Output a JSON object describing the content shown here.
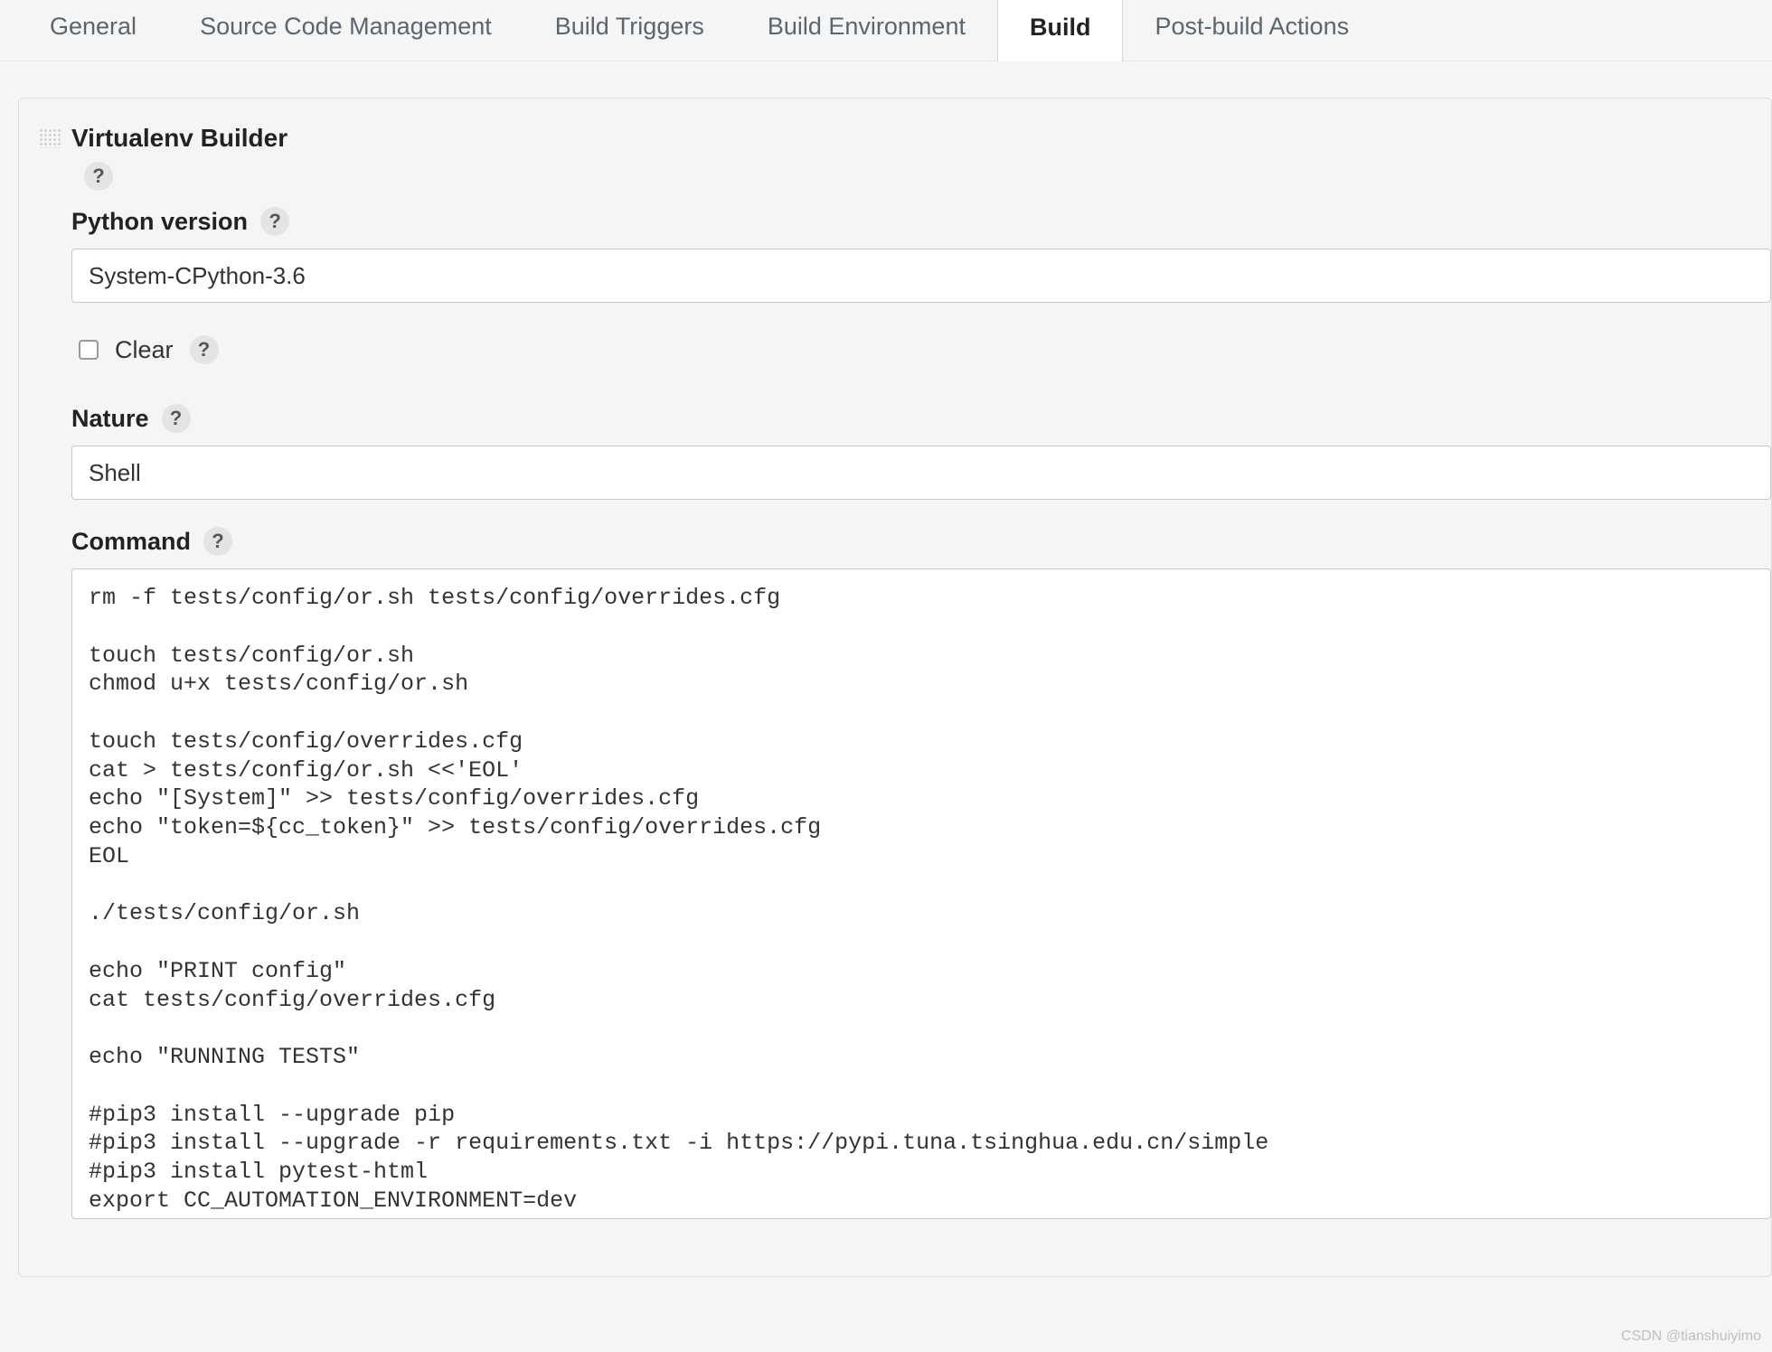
{
  "tabs": {
    "general": "General",
    "scm": "Source Code Management",
    "triggers": "Build Triggers",
    "environment": "Build Environment",
    "build": "Build",
    "postbuild": "Post-build Actions"
  },
  "step": {
    "title": "Virtualenv Builder",
    "help": "?",
    "python_version": {
      "label": "Python version",
      "value": "System-CPython-3.6",
      "help": "?"
    },
    "clear": {
      "label": "Clear",
      "help": "?"
    },
    "nature": {
      "label": "Nature",
      "value": "Shell",
      "help": "?"
    },
    "command": {
      "label": "Command",
      "help": "?",
      "value": "rm -f tests/config/or.sh tests/config/overrides.cfg\n\ntouch tests/config/or.sh\nchmod u+x tests/config/or.sh\n\ntouch tests/config/overrides.cfg\ncat > tests/config/or.sh <<'EOL'\necho \"[System]\" >> tests/config/overrides.cfg\necho \"token=${cc_token}\" >> tests/config/overrides.cfg\nEOL\n\n./tests/config/or.sh\n\necho \"PRINT config\"\ncat tests/config/overrides.cfg\n\necho \"RUNNING TESTS\"\n\n#pip3 install --upgrade pip\n#pip3 install --upgrade -r requirements.txt -i https://pypi.tuna.tsinghua.edu.cn/simple\n#pip3 install pytest-html\nexport CC_AUTOMATION_ENVIRONMENT=dev"
    }
  },
  "watermark": "CSDN @tianshuiyimo"
}
